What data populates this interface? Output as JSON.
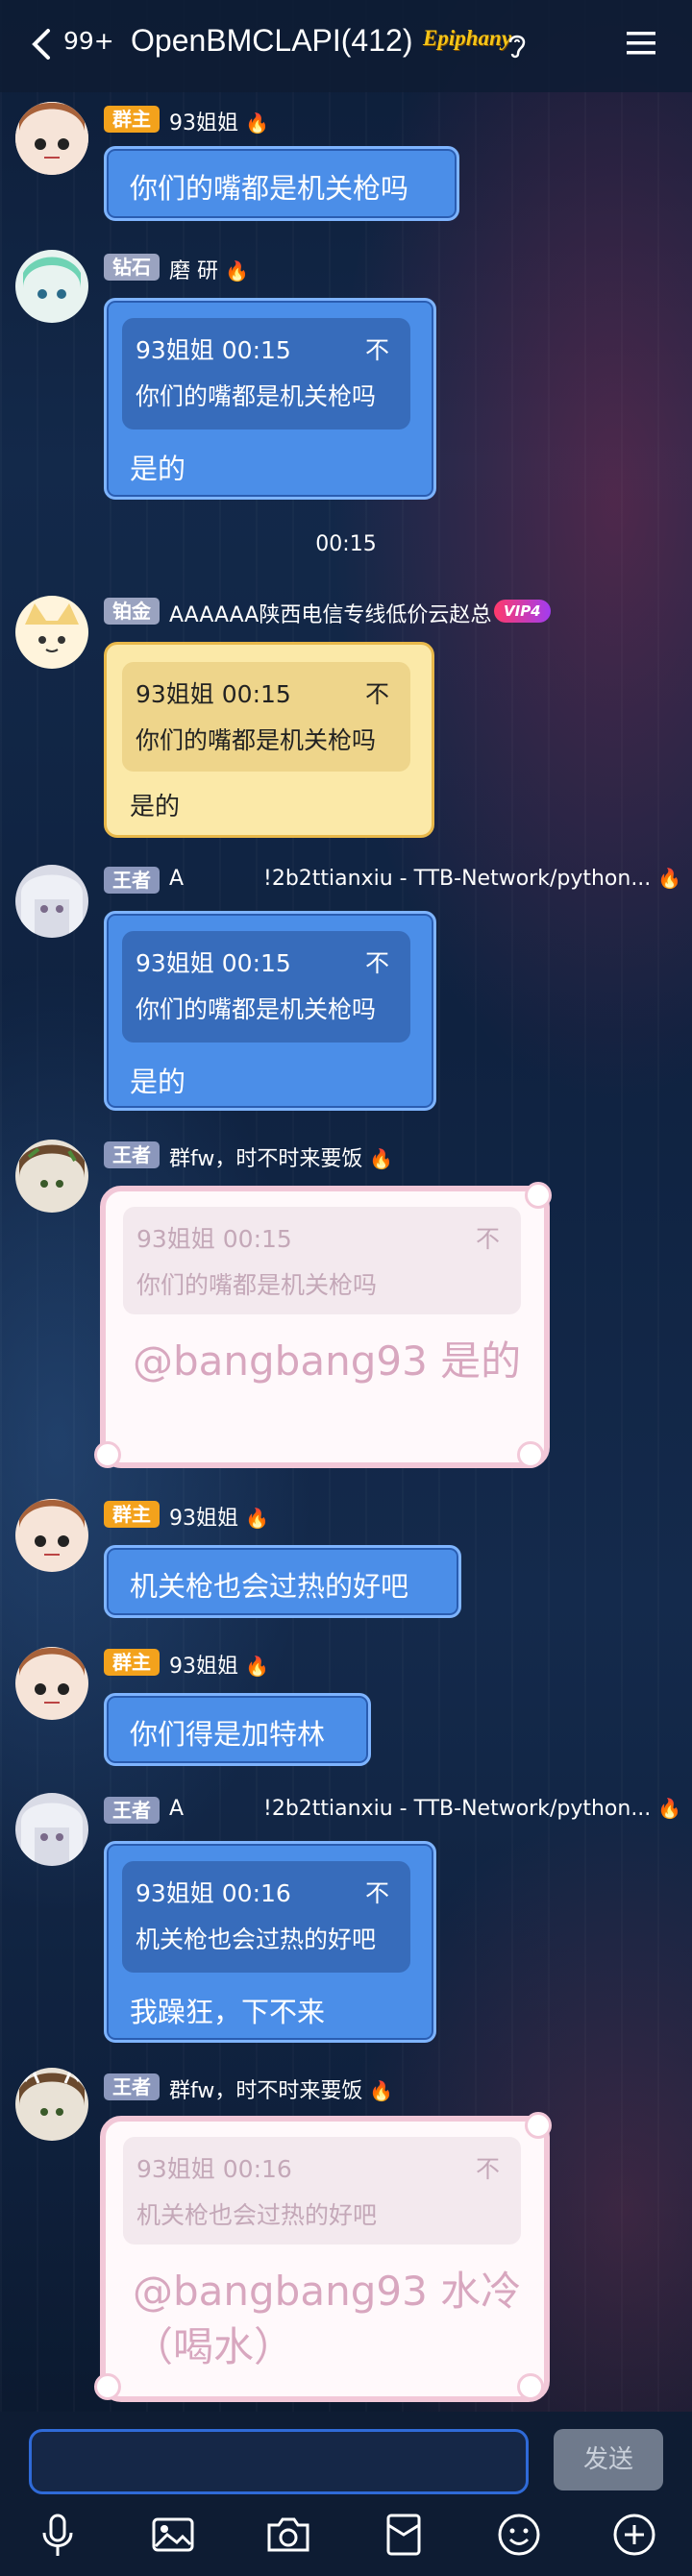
{
  "header": {
    "unread": "99+",
    "title": "OpenBMCLAPI(412)",
    "badge": "Epiphany"
  },
  "messages": [
    {
      "tag": "群主",
      "name": "93姐姐",
      "text": "你们的嘴都是机关枪吗"
    },
    {
      "tag": "钻石",
      "name": "磨 研",
      "quote_name": "93姐姐 00:15",
      "quote_text": "你们的嘴都是机关枪吗",
      "text": "是的"
    },
    {
      "time": "00:15"
    },
    {
      "tag": "铂金",
      "name": "AAAAAA陕西电信专线低价云赵总",
      "vip": "VIP4",
      "quote_name": "93姐姐 00:15",
      "quote_text": "你们的嘴都是机关枪吗",
      "text": "是的"
    },
    {
      "tag": "王者",
      "name": "A",
      "name_extra": "!2b2ttianxiu - TTB-Network/python...",
      "quote_name": "93姐姐 00:15",
      "quote_text": "你们的嘴都是机关枪吗",
      "text": "是的"
    },
    {
      "tag": "王者",
      "name": "群fw，时不时来要饭",
      "quote_name": "93姐姐 00:15",
      "quote_text": "你们的嘴都是机关枪吗",
      "text": "@bangbang93 是的"
    },
    {
      "tag": "群主",
      "name": "93姐姐",
      "text": "机关枪也会过热的好吧"
    },
    {
      "tag": "群主",
      "name": "93姐姐",
      "text": "你们得是加特林"
    },
    {
      "tag": "王者",
      "name": "A",
      "name_extra": "!2b2ttianxiu - TTB-Network/python...",
      "quote_name": "93姐姐 00:16",
      "quote_text": "机关枪也会过热的好吧",
      "text": "我躁狂，下不来"
    },
    {
      "tag": "王者",
      "name": "群fw，时不时来要饭",
      "quote_name": "93姐姐 00:16",
      "quote_text": "机关枪也会过热的好吧",
      "text": "@bangbang93 水冷（喝水）"
    }
  ],
  "quote_close": "不",
  "input": {
    "placeholder": "",
    "send_label": "发送"
  },
  "toolbar": [
    "microphone-icon",
    "image-icon",
    "camera-icon",
    "red-packet-icon",
    "emoji-icon",
    "plus-icon"
  ],
  "colors": {
    "owner_tag": "#f3a21c",
    "blue_bubble": "#4b8ee8",
    "send_button": "#6f7a8c"
  }
}
